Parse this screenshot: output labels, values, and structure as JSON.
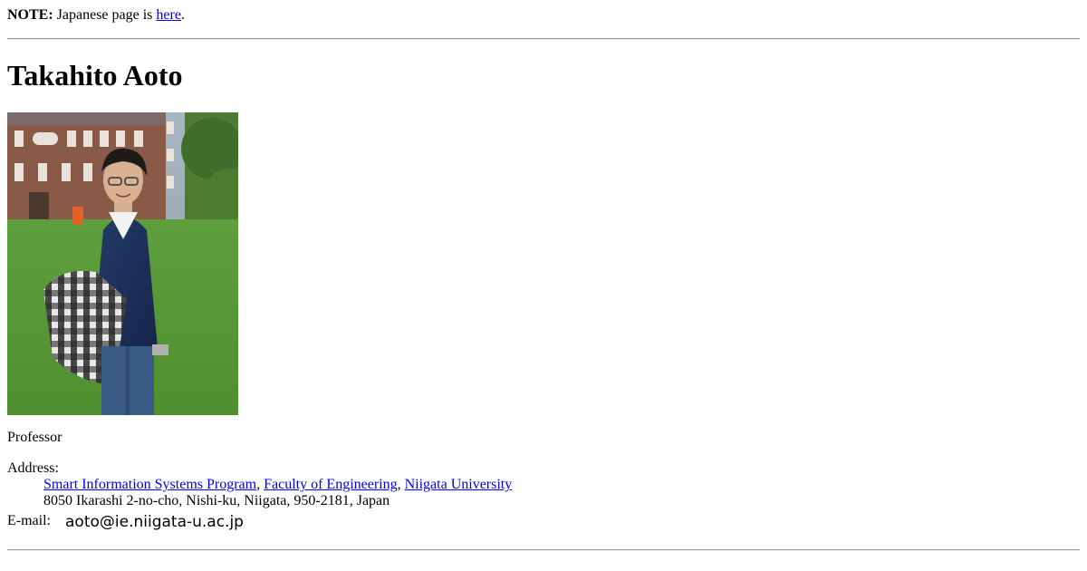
{
  "note": {
    "label": "NOTE:",
    "text": " Japanese page is ",
    "link_text": "here",
    "suffix": "."
  },
  "profile": {
    "name": "Takahito Aoto",
    "photo_description": "portrait photo",
    "position": "Professor"
  },
  "address": {
    "label": "Address:",
    "program_link": "Smart Information Systems Program",
    "sep1": ", ",
    "faculty_link": "Faculty of Engineering",
    "sep2": ", ",
    "university_link": "Niigata University",
    "street": "8050 Ikarashi 2-no-cho, Nishi-ku, Niigata, 950-2181, Japan"
  },
  "email": {
    "label": "E-mail:",
    "address_image_text": "aoto@ie.niigata-u.ac.jp"
  },
  "colors": {
    "link": "#0000ee",
    "rule": "#9a9a9a"
  }
}
